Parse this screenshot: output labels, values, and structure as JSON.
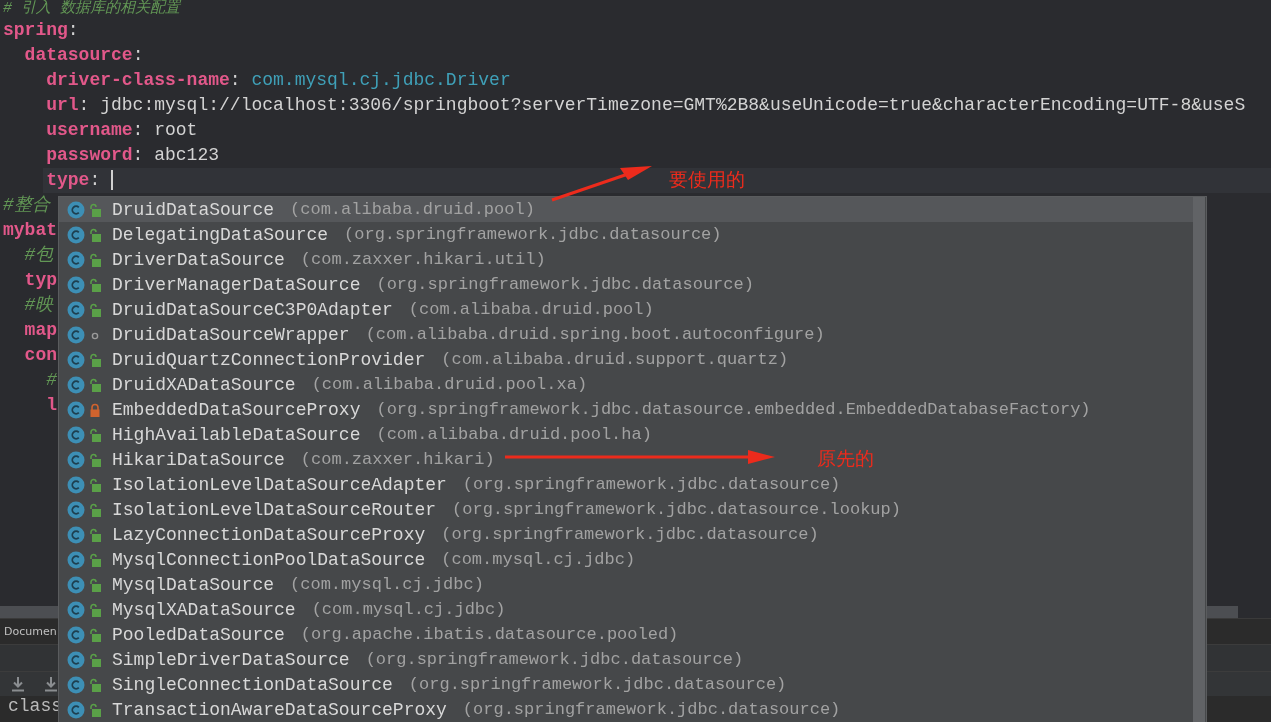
{
  "editor": {
    "lines": [
      {
        "kind": "comment",
        "text": "# 引入 数据库的相关配置"
      },
      {
        "kind": "key",
        "key": "spring",
        "punct": ":",
        "children": [
          {
            "kind": "key",
            "key": "datasource",
            "punct": ":",
            "children": [
              {
                "kind": "key",
                "key": "driver-class-name",
                "punct": ":",
                "value": {
                  "kind": "class",
                  "text": "com.mysql.cj.jdbc.Driver"
                }
              },
              {
                "kind": "key",
                "key": "url",
                "punct": ":",
                "value": {
                  "kind": "plain",
                  "text": "jdbc:mysql://localhost:3306/springboot?serverTimezone=GMT%2B8&useUnicode=true&characterEncoding=UTF-8&useS"
                }
              },
              {
                "kind": "key",
                "key": "username",
                "punct": ":",
                "value": {
                  "kind": "plain",
                  "text": "root"
                }
              },
              {
                "kind": "key",
                "key": "password",
                "punct": ":",
                "value": {
                  "kind": "plain",
                  "text": "abc123"
                }
              },
              {
                "kind": "key",
                "key": "type",
                "punct": ":",
                "caret": true
              }
            ]
          }
        ]
      },
      {
        "kind": "comment",
        "text": "#整合"
      },
      {
        "kind": "key",
        "key": "mybat",
        "children": [
          {
            "kind": "comment",
            "text": "#包"
          },
          {
            "kind": "key",
            "key": "typ"
          },
          {
            "kind": "comment",
            "text": "#映"
          },
          {
            "kind": "key",
            "key": "map"
          },
          {
            "kind": "key",
            "key": "con",
            "children": [
              {
                "kind": "comment",
                "text": "#"
              },
              {
                "kind": "key",
                "key": "l"
              }
            ]
          }
        ]
      }
    ]
  },
  "popup": {
    "items": [
      {
        "name": "DruidDataSource",
        "package": "(com.alibaba.druid.pool)",
        "kind": "public",
        "selected": true
      },
      {
        "name": "DelegatingDataSource",
        "package": "(org.springframework.jdbc.datasource)",
        "kind": "public",
        "selected": false
      },
      {
        "name": "DriverDataSource",
        "package": "(com.zaxxer.hikari.util)",
        "kind": "public",
        "selected": false
      },
      {
        "name": "DriverManagerDataSource",
        "package": "(org.springframework.jdbc.datasource)",
        "kind": "public",
        "selected": false
      },
      {
        "name": "DruidDataSourceC3P0Adapter",
        "package": "(com.alibaba.druid.pool)",
        "kind": "public",
        "selected": false
      },
      {
        "name": "DruidDataSourceWrapper",
        "package": "(com.alibaba.druid.spring.boot.autoconfigure)",
        "kind": "package",
        "selected": false
      },
      {
        "name": "DruidQuartzConnectionProvider",
        "package": "(com.alibaba.druid.support.quartz)",
        "kind": "public",
        "selected": false
      },
      {
        "name": "DruidXADataSource",
        "package": "(com.alibaba.druid.pool.xa)",
        "kind": "public",
        "selected": false
      },
      {
        "name": "EmbeddedDataSourceProxy",
        "package": "(org.springframework.jdbc.datasource.embedded.EmbeddedDatabaseFactory)",
        "kind": "private",
        "selected": false
      },
      {
        "name": "HighAvailableDataSource",
        "package": "(com.alibaba.druid.pool.ha)",
        "kind": "public",
        "selected": false
      },
      {
        "name": "HikariDataSource",
        "package": "(com.zaxxer.hikari)",
        "kind": "public",
        "selected": false
      },
      {
        "name": "IsolationLevelDataSourceAdapter",
        "package": "(org.springframework.jdbc.datasource)",
        "kind": "public",
        "selected": false
      },
      {
        "name": "IsolationLevelDataSourceRouter",
        "package": "(org.springframework.jdbc.datasource.lookup)",
        "kind": "public",
        "selected": false
      },
      {
        "name": "LazyConnectionDataSourceProxy",
        "package": "(org.springframework.jdbc.datasource)",
        "kind": "public",
        "selected": false
      },
      {
        "name": "MysqlConnectionPoolDataSource",
        "package": "(com.mysql.cj.jdbc)",
        "kind": "public",
        "selected": false
      },
      {
        "name": "MysqlDataSource",
        "package": "(com.mysql.cj.jdbc)",
        "kind": "public",
        "selected": false
      },
      {
        "name": "MysqlXADataSource",
        "package": "(com.mysql.cj.jdbc)",
        "kind": "public",
        "selected": false
      },
      {
        "name": "PooledDataSource",
        "package": "(org.apache.ibatis.datasource.pooled)",
        "kind": "public",
        "selected": false
      },
      {
        "name": "SimpleDriverDataSource",
        "package": "(org.springframework.jdbc.datasource)",
        "kind": "public",
        "selected": false
      },
      {
        "name": "SingleConnectionDataSource",
        "package": "(org.springframework.jdbc.datasource)",
        "kind": "public",
        "selected": false
      },
      {
        "name": "TransactionAwareDataSourceProxy",
        "package": "(org.springframework.jdbc.datasource)",
        "kind": "public",
        "selected": false
      }
    ]
  },
  "bottom_panel": {
    "tab": "Documen",
    "text": "class"
  },
  "annotations": [
    {
      "text": "要使用的"
    },
    {
      "text": "原先的"
    }
  ]
}
